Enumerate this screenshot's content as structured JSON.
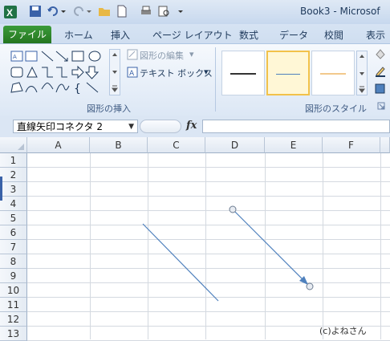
{
  "window": {
    "title": "Book3 - Microsof"
  },
  "tabs": {
    "file": "ファイル",
    "items": [
      "ホーム",
      "挿入",
      "ページ レイアウト",
      "数式",
      "データ",
      "校閲",
      "表示"
    ]
  },
  "ribbon": {
    "insert_shapes_group": "図形の挿入",
    "shape_styles_group": "図形のスタイル",
    "edit_shape": "図形の編集",
    "text_box": "テキスト ボックス"
  },
  "formula_bar": {
    "name_box": "直線矢印コネクタ 2",
    "fx": "fx",
    "formula": ""
  },
  "sheet": {
    "columns": [
      "A",
      "B",
      "C",
      "D",
      "E",
      "F"
    ],
    "rows": [
      "1",
      "2",
      "3",
      "4",
      "5",
      "6",
      "7",
      "8",
      "9",
      "10",
      "11",
      "12",
      "13"
    ]
  },
  "credit": "(c)よねさん",
  "colors": {
    "file_tab": "#2e8b2b",
    "line": "#4f81bd",
    "selection": "#f2c24a"
  },
  "icons": [
    "excel-logo-icon",
    "save-icon",
    "undo-icon",
    "redo-icon",
    "open-folder-icon",
    "new-doc-icon",
    "print-icon",
    "print-preview-icon"
  ]
}
